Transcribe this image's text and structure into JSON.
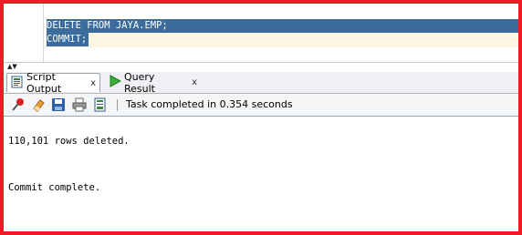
{
  "editor": {
    "lines": [
      "DELETE FROM JAYA.EMP;",
      "COMMIT;"
    ]
  },
  "tabs": [
    {
      "label": "Script Output",
      "close": "x",
      "icon": "script-output-icon"
    },
    {
      "label": "Query Result",
      "close": "x",
      "icon": "run-arrow-icon"
    }
  ],
  "toolbar": {
    "icons": [
      "pin-icon",
      "eraser-icon",
      "save-icon",
      "print-icon",
      "export-icon"
    ],
    "status": "Task completed in 0.354 seconds"
  },
  "output": {
    "lines": [
      "110,101 rows deleted.",
      "Commit complete."
    ]
  },
  "colors": {
    "frame": "#ed1c24",
    "selection": "#3b6c9b",
    "current_line": "#fdf6e3"
  }
}
